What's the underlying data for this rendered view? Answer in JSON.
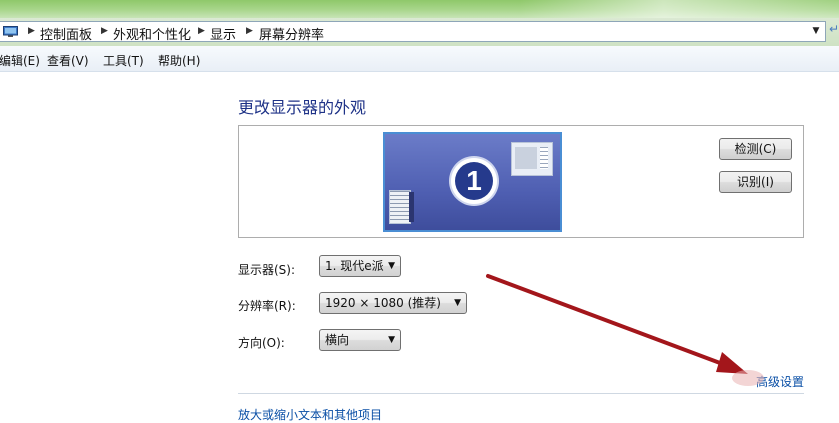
{
  "address_bar": {
    "breadcrumbs": [
      "控制面板",
      "外观和个性化",
      "显示",
      "屏幕分辨率"
    ],
    "computer_icon": "computer-icon",
    "dropdown_icon": "chevron-down-icon"
  },
  "menu": {
    "items": [
      "编辑(E)",
      "查看(V)",
      "工具(T)",
      "帮助(H)"
    ]
  },
  "main": {
    "title": "更改显示器的外观",
    "monitor_number": "1",
    "detect_button": "检测(C)",
    "identify_button": "识别(I)",
    "display_label": "显示器(S):",
    "display_value": "1. 现代e派",
    "resolution_label": "分辨率(R):",
    "resolution_value": "1920 × 1080 (推荐)",
    "orientation_label": "方向(O):",
    "orientation_value": "横向",
    "advanced_link": "高级设置",
    "text_size_link": "放大或缩小文本和其他项目"
  },
  "colors": {
    "title_text": "#1e3287",
    "link": "#0a4fa6",
    "annotation_arrow": "#a3161b"
  }
}
